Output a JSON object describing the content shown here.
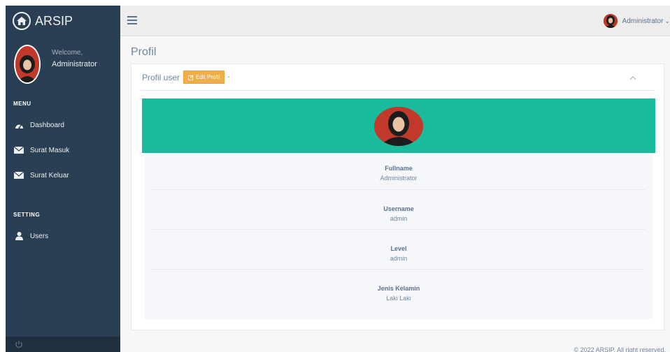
{
  "brand": {
    "title": "ARSIP"
  },
  "sidebar": {
    "welcome": "Welcome,",
    "username": "Administrator",
    "menu_title": "MENU",
    "menu_items": [
      {
        "label": "Dashboard",
        "icon": "dashboard-icon"
      },
      {
        "label": "Surat Masuk",
        "icon": "envelope-icon"
      },
      {
        "label": "Surat Keluar",
        "icon": "envelope-icon"
      }
    ],
    "setting_title": "SETTING",
    "setting_items": [
      {
        "label": "Users",
        "icon": "user-icon"
      }
    ]
  },
  "topnav": {
    "username": "Administrator",
    "caret": "⌄"
  },
  "page": {
    "title": "Profil"
  },
  "panel": {
    "title": "Profil user",
    "edit_button": "Edit Profil",
    "dash": "-"
  },
  "profile": {
    "fields": [
      {
        "label": "Fullname",
        "value": "Administrator"
      },
      {
        "label": "Username",
        "value": "admin"
      },
      {
        "label": "Level",
        "value": "admin"
      },
      {
        "label": "Jenis Kelamin",
        "value": "Laki Laki"
      }
    ]
  },
  "footer": {
    "copyright": "© 2022 ARSIP. All right reserved."
  },
  "colors": {
    "sidebar": "#2a3f54",
    "accent": "#1abb9c",
    "edit_button": "#f0ad4e",
    "text": "#73879c"
  }
}
